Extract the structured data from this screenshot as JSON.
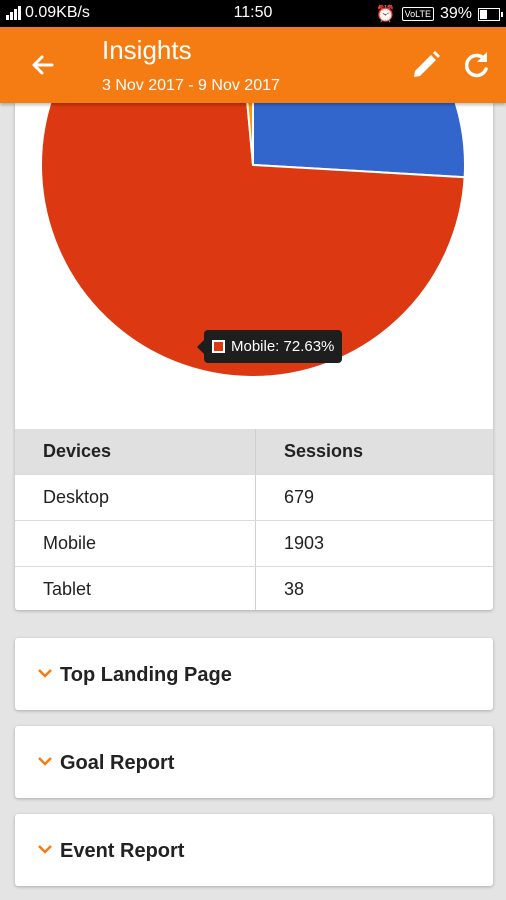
{
  "status_bar": {
    "network_speed": "0.09KB/s",
    "time": "11:50",
    "network_type": "VoLTE",
    "battery": "39%"
  },
  "header": {
    "title": "Insights",
    "date_range": "3 Nov 2017 - 9 Nov 2017"
  },
  "chart_data": {
    "type": "pie",
    "slices": [
      {
        "name": "Desktop",
        "value": 679,
        "color": "#3366cc"
      },
      {
        "name": "Mobile",
        "value": 1903,
        "color": "#dc3912"
      },
      {
        "name": "Tablet",
        "value": 38,
        "color": "#ff9900"
      }
    ],
    "tooltip": "Mobile: 72.63%"
  },
  "table": {
    "headers": [
      "Devices",
      "Sessions"
    ],
    "rows": [
      [
        "Desktop",
        "679"
      ],
      [
        "Mobile",
        "1903"
      ],
      [
        "Tablet",
        "38"
      ]
    ]
  },
  "sections": [
    {
      "label": "Top Landing Page"
    },
    {
      "label": "Goal Report"
    },
    {
      "label": "Event Report"
    }
  ],
  "colors": {
    "accent": "#f57c13",
    "mobile": "#dc3912",
    "desktop": "#3366cc"
  }
}
